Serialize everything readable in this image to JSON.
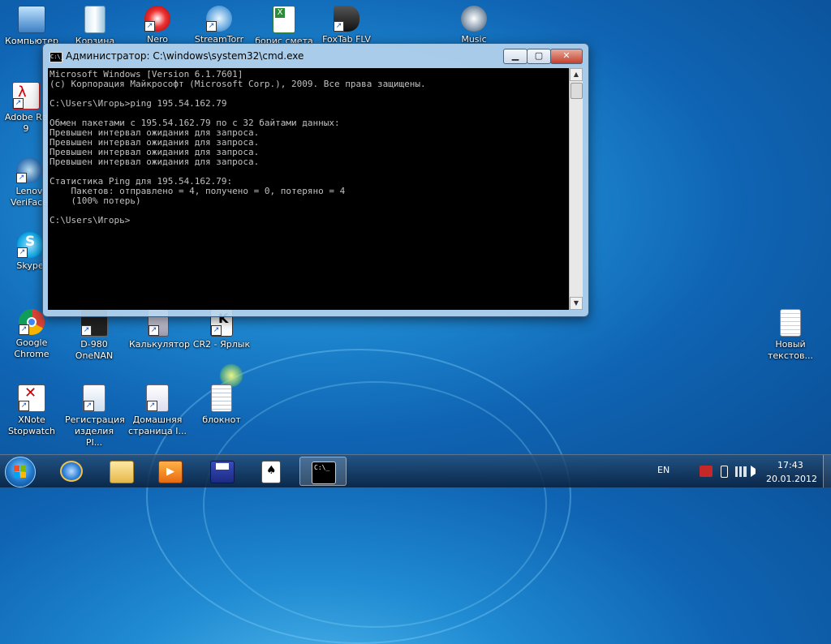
{
  "desktop": {
    "icons": [
      {
        "label": "Компьютер",
        "name": "computer"
      },
      {
        "label": "Корзина",
        "name": "recycle-bin"
      },
      {
        "label": "Nero",
        "name": "nero"
      },
      {
        "label": "StreamTorr",
        "name": "streamtorr"
      },
      {
        "label": "борис смета",
        "name": "excel-file"
      },
      {
        "label": "FoxTab FLV",
        "name": "foxtab-flv"
      },
      {
        "label": "Music",
        "name": "music"
      },
      {
        "label": "Adobe Re\n9",
        "name": "adobe-reader"
      },
      {
        "label": "Lenov\nVeriFace",
        "name": "lenovo-veriface"
      },
      {
        "label": "Skype",
        "name": "skype"
      },
      {
        "label": "Google\nChrome",
        "name": "google-chrome"
      },
      {
        "label": "D-980\nOneNAN",
        "name": "d980-onenan"
      },
      {
        "label": "Калькулятор",
        "name": "calculator"
      },
      {
        "label": "CR2 - Ярлык",
        "name": "cr2-shortcut"
      },
      {
        "label": "XNote\nStopwatch",
        "name": "xnote-stopwatch"
      },
      {
        "label": "Регистрация\nизделия PI...",
        "name": "product-registration"
      },
      {
        "label": "Домашняя\nстраница I...",
        "name": "home-page"
      },
      {
        "label": "блокнот",
        "name": "notepad"
      },
      {
        "label": "Новый\nтекстов...",
        "name": "new-text-file"
      }
    ]
  },
  "cmd_window": {
    "title": "Администратор: C:\\windows\\system32\\cmd.exe",
    "titlebar_icon_text": "C:\\_",
    "console_lines": [
      "Microsoft Windows [Version 6.1.7601]",
      "(c) Корпорация Майкрософт (Microsoft Corp.), 2009. Все права защищены.",
      "",
      "C:\\Users\\Игорь>ping 195.54.162.79",
      "",
      "Обмен пакетами с 195.54.162.79 по с 32 байтами данных:",
      "Превышен интервал ожидания для запроса.",
      "Превышен интервал ожидания для запроса.",
      "Превышен интервал ожидания для запроса.",
      "Превышен интервал ожидания для запроса.",
      "",
      "Статистика Ping для 195.54.162.79:",
      "    Пакетов: отправлено = 4, получено = 0, потеряно = 4",
      "    (100% потерь)",
      "",
      "C:\\Users\\Игорь>"
    ]
  },
  "taskbar": {
    "apps": [
      "internet-explorer-icon",
      "explorer-icon",
      "media-player-icon",
      "save-disk-icon",
      "solitaire-icon",
      "cmd-icon"
    ],
    "cmd_icon_text": "C:\\_",
    "language": "EN",
    "time": "17:43",
    "date": "20.01.2012"
  },
  "colors": {
    "console_bg": "#000000",
    "console_fg": "#c0c0c0",
    "taskbar": "#1b3a5c"
  }
}
